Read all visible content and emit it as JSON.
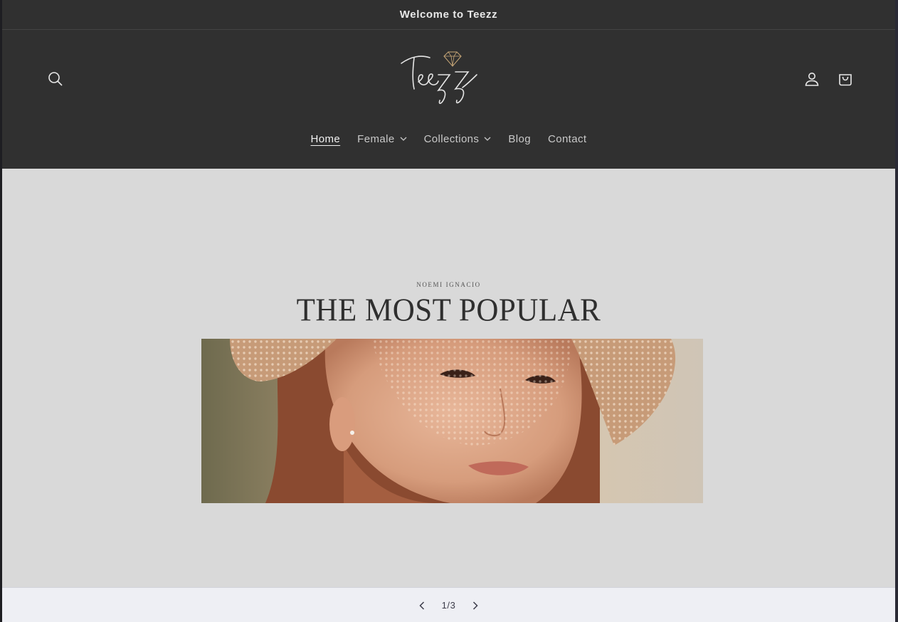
{
  "announcement": "Welcome to Teezz",
  "header": {
    "logo_text": "Teezz",
    "nav": [
      {
        "label": "Home",
        "active": true,
        "dropdown": false
      },
      {
        "label": "Female",
        "active": false,
        "dropdown": true
      },
      {
        "label": "Collections",
        "active": false,
        "dropdown": true
      },
      {
        "label": "Blog",
        "active": false,
        "dropdown": false
      },
      {
        "label": "Contact",
        "active": false,
        "dropdown": false
      }
    ],
    "icons": [
      "search-icon",
      "account-icon",
      "cart-icon"
    ]
  },
  "hero": {
    "subheading": "NOEMI IGNACIO",
    "heading": "THE MOST POPULAR"
  },
  "slider": {
    "counter": "1/3"
  },
  "colors": {
    "header_bg": "#303030",
    "hero_bg": "#d9d9d9",
    "slider_bg": "#eeeff4"
  }
}
